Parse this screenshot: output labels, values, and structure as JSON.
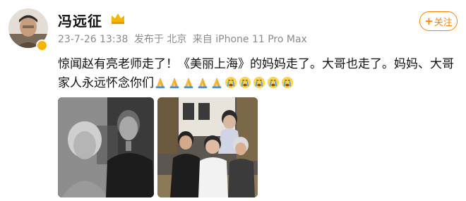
{
  "user": {
    "name": "冯远征",
    "timestamp": "23-7-26 13:38",
    "location": "发布于 北京",
    "source": "来自 iPhone 11 Pro Max",
    "follow_label": "关注",
    "follow_plus": "+"
  },
  "post": {
    "text": "惊闻赵有亮老师走了！《美丽上海》的妈妈走了。大哥也走了。妈妈、大哥家人永远怀念你们",
    "emojis": [
      "pray-icon",
      "pray-icon",
      "pray-icon",
      "pray-icon",
      "pray-icon",
      "crying-face-icon",
      "crying-face-icon",
      "crying-face-icon",
      "crying-face-icon",
      "crying-face-icon"
    ]
  },
  "colors": {
    "accent": "#ff8200",
    "meta_text": "#8a8a8a"
  }
}
